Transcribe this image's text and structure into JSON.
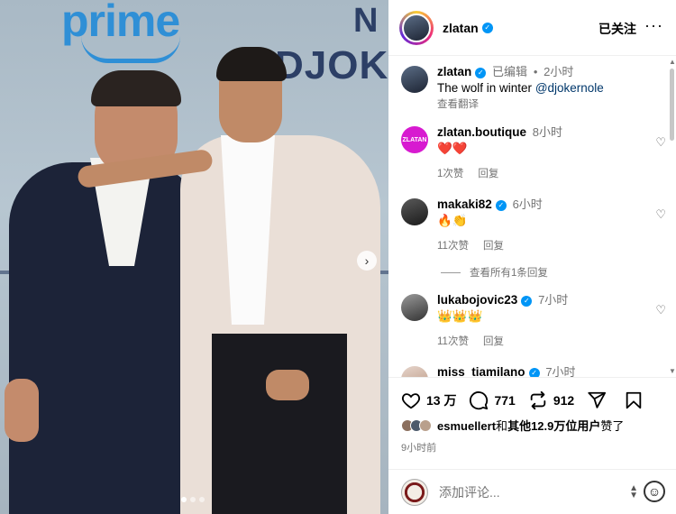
{
  "photo": {
    "backdrop": {
      "brand_top": "prime",
      "letter_n": "N",
      "name_partial": "DJOKER"
    },
    "next_arrow": "›",
    "slide_count": 3,
    "active_slide": 1
  },
  "header": {
    "username": "zlatan",
    "verified_mark": "✓",
    "follow_state": "已关注",
    "more_glyph": "···"
  },
  "caption": {
    "username": "zlatan",
    "edited": "已编辑",
    "separator": "•",
    "time": "2小时",
    "text": "The wolf in winter",
    "mention": "@djokernole",
    "translate": "查看翻译"
  },
  "comments": [
    {
      "username": "zlatan.boutique",
      "avatar_text": "ZLATAN",
      "verified": false,
      "time": "8小时",
      "text": "❤️❤️",
      "likes": "1次赞",
      "reply": "回复"
    },
    {
      "username": "makaki82",
      "verified": true,
      "time": "6小时",
      "text": "🔥👏",
      "likes": "11次赞",
      "reply": "回复"
    },
    {
      "username": "lukabojovic23",
      "verified": true,
      "time": "7小时",
      "text": "👑👑👑",
      "likes": "11次赞",
      "reply": "回复"
    },
    {
      "username": "miss_tiamilano",
      "verified": true,
      "time": "7小时"
    }
  ],
  "view_replies": "查看所有1条回复",
  "actions": {
    "likes_count": "13 万",
    "comments_count": "771",
    "reposts_count": "912"
  },
  "likes_summary": {
    "user": "esmuellert",
    "middle": "和",
    "others": "其他12.9万位用户",
    "suffix": "赞了"
  },
  "posted_ago": "9小时前",
  "comment_box": {
    "placeholder": "添加评论...",
    "emoji_glyph": "☺"
  },
  "colors": {
    "verified_blue": "#0095f6",
    "mention_blue": "#00376b",
    "secondary_text": "#737373"
  }
}
